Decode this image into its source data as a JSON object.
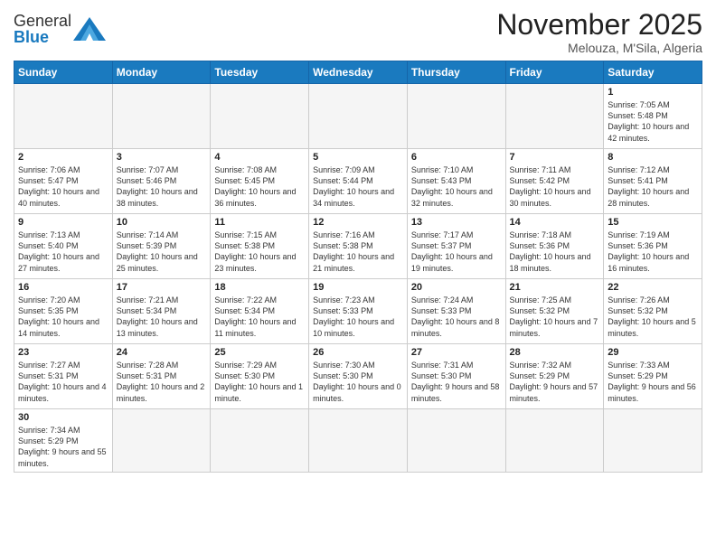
{
  "logo": {
    "text_general": "General",
    "text_blue": "Blue"
  },
  "title": "November 2025",
  "location": "Melouza, M'Sila, Algeria",
  "weekdays": [
    "Sunday",
    "Monday",
    "Tuesday",
    "Wednesday",
    "Thursday",
    "Friday",
    "Saturday"
  ],
  "days": [
    {
      "num": "",
      "info": ""
    },
    {
      "num": "",
      "info": ""
    },
    {
      "num": "",
      "info": ""
    },
    {
      "num": "",
      "info": ""
    },
    {
      "num": "",
      "info": ""
    },
    {
      "num": "",
      "info": ""
    },
    {
      "num": "1",
      "info": "Sunrise: 7:05 AM\nSunset: 5:48 PM\nDaylight: 10 hours and 42 minutes."
    },
    {
      "num": "2",
      "info": "Sunrise: 7:06 AM\nSunset: 5:47 PM\nDaylight: 10 hours and 40 minutes."
    },
    {
      "num": "3",
      "info": "Sunrise: 7:07 AM\nSunset: 5:46 PM\nDaylight: 10 hours and 38 minutes."
    },
    {
      "num": "4",
      "info": "Sunrise: 7:08 AM\nSunset: 5:45 PM\nDaylight: 10 hours and 36 minutes."
    },
    {
      "num": "5",
      "info": "Sunrise: 7:09 AM\nSunset: 5:44 PM\nDaylight: 10 hours and 34 minutes."
    },
    {
      "num": "6",
      "info": "Sunrise: 7:10 AM\nSunset: 5:43 PM\nDaylight: 10 hours and 32 minutes."
    },
    {
      "num": "7",
      "info": "Sunrise: 7:11 AM\nSunset: 5:42 PM\nDaylight: 10 hours and 30 minutes."
    },
    {
      "num": "8",
      "info": "Sunrise: 7:12 AM\nSunset: 5:41 PM\nDaylight: 10 hours and 28 minutes."
    },
    {
      "num": "9",
      "info": "Sunrise: 7:13 AM\nSunset: 5:40 PM\nDaylight: 10 hours and 27 minutes."
    },
    {
      "num": "10",
      "info": "Sunrise: 7:14 AM\nSunset: 5:39 PM\nDaylight: 10 hours and 25 minutes."
    },
    {
      "num": "11",
      "info": "Sunrise: 7:15 AM\nSunset: 5:38 PM\nDaylight: 10 hours and 23 minutes."
    },
    {
      "num": "12",
      "info": "Sunrise: 7:16 AM\nSunset: 5:38 PM\nDaylight: 10 hours and 21 minutes."
    },
    {
      "num": "13",
      "info": "Sunrise: 7:17 AM\nSunset: 5:37 PM\nDaylight: 10 hours and 19 minutes."
    },
    {
      "num": "14",
      "info": "Sunrise: 7:18 AM\nSunset: 5:36 PM\nDaylight: 10 hours and 18 minutes."
    },
    {
      "num": "15",
      "info": "Sunrise: 7:19 AM\nSunset: 5:36 PM\nDaylight: 10 hours and 16 minutes."
    },
    {
      "num": "16",
      "info": "Sunrise: 7:20 AM\nSunset: 5:35 PM\nDaylight: 10 hours and 14 minutes."
    },
    {
      "num": "17",
      "info": "Sunrise: 7:21 AM\nSunset: 5:34 PM\nDaylight: 10 hours and 13 minutes."
    },
    {
      "num": "18",
      "info": "Sunrise: 7:22 AM\nSunset: 5:34 PM\nDaylight: 10 hours and 11 minutes."
    },
    {
      "num": "19",
      "info": "Sunrise: 7:23 AM\nSunset: 5:33 PM\nDaylight: 10 hours and 10 minutes."
    },
    {
      "num": "20",
      "info": "Sunrise: 7:24 AM\nSunset: 5:33 PM\nDaylight: 10 hours and 8 minutes."
    },
    {
      "num": "21",
      "info": "Sunrise: 7:25 AM\nSunset: 5:32 PM\nDaylight: 10 hours and 7 minutes."
    },
    {
      "num": "22",
      "info": "Sunrise: 7:26 AM\nSunset: 5:32 PM\nDaylight: 10 hours and 5 minutes."
    },
    {
      "num": "23",
      "info": "Sunrise: 7:27 AM\nSunset: 5:31 PM\nDaylight: 10 hours and 4 minutes."
    },
    {
      "num": "24",
      "info": "Sunrise: 7:28 AM\nSunset: 5:31 PM\nDaylight: 10 hours and 2 minutes."
    },
    {
      "num": "25",
      "info": "Sunrise: 7:29 AM\nSunset: 5:30 PM\nDaylight: 10 hours and 1 minute."
    },
    {
      "num": "26",
      "info": "Sunrise: 7:30 AM\nSunset: 5:30 PM\nDaylight: 10 hours and 0 minutes."
    },
    {
      "num": "27",
      "info": "Sunrise: 7:31 AM\nSunset: 5:30 PM\nDaylight: 9 hours and 58 minutes."
    },
    {
      "num": "28",
      "info": "Sunrise: 7:32 AM\nSunset: 5:29 PM\nDaylight: 9 hours and 57 minutes."
    },
    {
      "num": "29",
      "info": "Sunrise: 7:33 AM\nSunset: 5:29 PM\nDaylight: 9 hours and 56 minutes."
    },
    {
      "num": "30",
      "info": "Sunrise: 7:34 AM\nSunset: 5:29 PM\nDaylight: 9 hours and 55 minutes."
    },
    {
      "num": "",
      "info": ""
    },
    {
      "num": "",
      "info": ""
    },
    {
      "num": "",
      "info": ""
    },
    {
      "num": "",
      "info": ""
    },
    {
      "num": "",
      "info": ""
    },
    {
      "num": "",
      "info": ""
    }
  ]
}
